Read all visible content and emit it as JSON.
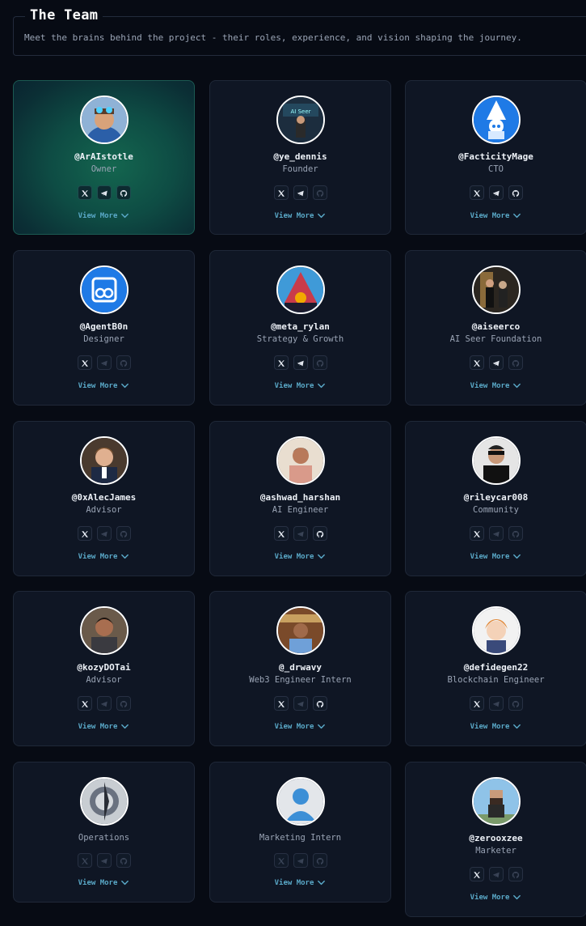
{
  "header": {
    "title": "The Team",
    "description": "Meet the brains behind the project - their roles, experience, and vision shaping the journey."
  },
  "view_more_label": "View More",
  "accent_color": "#5aa9c8",
  "members": [
    {
      "handle": "@ArAIstotle",
      "role": "Owner",
      "x": true,
      "telegram": true,
      "github": true,
      "highlight": true
    },
    {
      "handle": "@ye_dennis",
      "role": "Founder",
      "x": true,
      "telegram": true,
      "github": false
    },
    {
      "handle": "@FacticityMage",
      "role": "CTO",
      "x": true,
      "telegram": true,
      "github": true
    },
    {
      "handle": "@AgentB0n",
      "role": "Designer",
      "x": true,
      "telegram": false,
      "github": false
    },
    {
      "handle": "@meta_rylan",
      "role": "Strategy & Growth",
      "x": true,
      "telegram": true,
      "github": false
    },
    {
      "handle": "@aiseerco",
      "role": "AI Seer Foundation",
      "x": true,
      "telegram": true,
      "github": false
    },
    {
      "handle": "@0xAlecJames",
      "role": "Advisor",
      "x": true,
      "telegram": false,
      "github": false
    },
    {
      "handle": "@ashwad_harshan",
      "role": "AI Engineer",
      "x": true,
      "telegram": false,
      "github": true
    },
    {
      "handle": "@rileycar008",
      "role": "Community",
      "x": true,
      "telegram": false,
      "github": false
    },
    {
      "handle": "@kozyDOTai",
      "role": "Advisor",
      "x": true,
      "telegram": false,
      "github": false
    },
    {
      "handle": "@_drwavy",
      "role": "Web3 Engineer Intern",
      "x": true,
      "telegram": false,
      "github": true
    },
    {
      "handle": "@defidegen22",
      "role": "Blockchain Engineer",
      "x": true,
      "telegram": false,
      "github": false
    },
    {
      "handle": "",
      "role": "Operations",
      "x": false,
      "telegram": false,
      "github": false
    },
    {
      "handle": "",
      "role": "Marketing Intern",
      "x": false,
      "telegram": false,
      "github": false
    },
    {
      "handle": "@zerooxzee",
      "role": "Marketer",
      "x": true,
      "telegram": false,
      "github": false
    }
  ]
}
